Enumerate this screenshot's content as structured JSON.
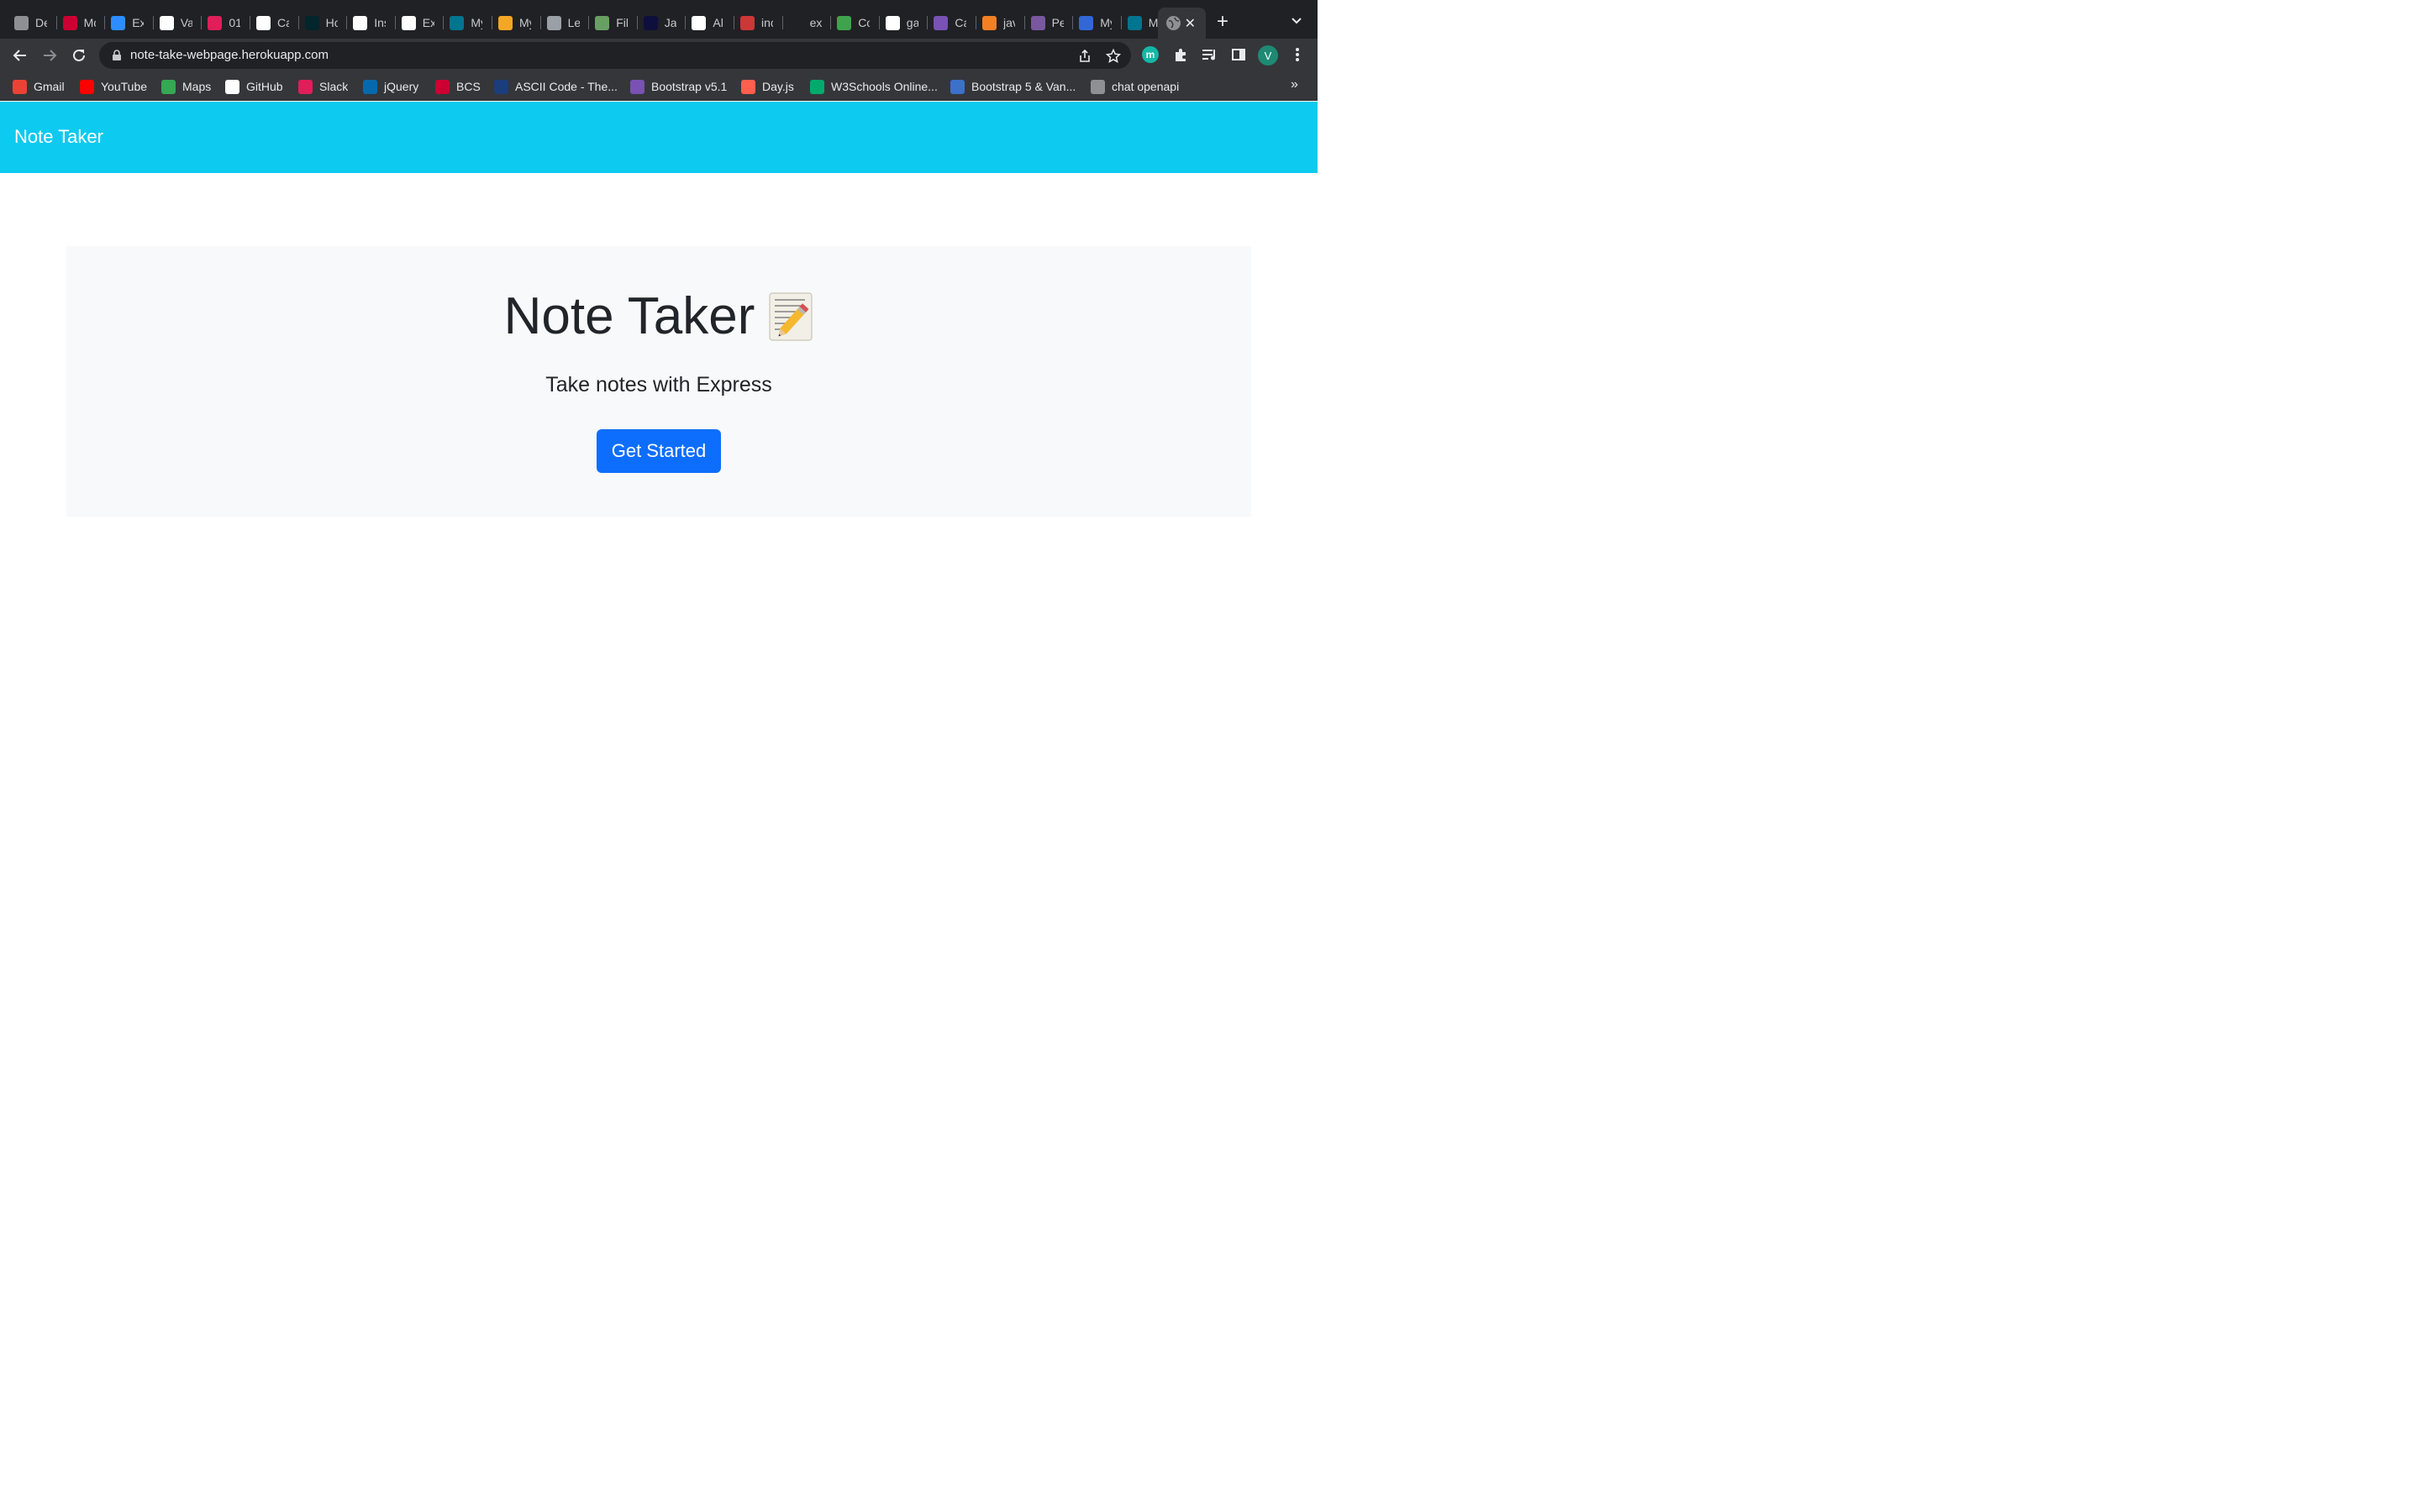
{
  "browser": {
    "tabs": [
      {
        "title": "De",
        "icon": "openai-icon",
        "color": "#8e9094"
      },
      {
        "title": "Mo",
        "icon": "rutgers-r-icon",
        "color": "#cc0033"
      },
      {
        "title": "Ex",
        "icon": "zoom-icon",
        "color": "#2d8cff"
      },
      {
        "title": "Va",
        "icon": "github-icon",
        "color": "#ffffff"
      },
      {
        "title": "01",
        "icon": "slack-icon",
        "color": "#e01e5a"
      },
      {
        "title": "Ca",
        "icon": "edx-icon",
        "color": "#ffffff"
      },
      {
        "title": "Ho",
        "icon": "edx-small-icon",
        "color": "#02262b"
      },
      {
        "title": "Ins",
        "icon": "express-icon",
        "color": "#ffffff"
      },
      {
        "title": "Ex",
        "icon": "express-icon",
        "color": "#ffffff"
      },
      {
        "title": "My",
        "icon": "mysql-icon",
        "color": "#00758f"
      },
      {
        "title": "My",
        "icon": "fs-icon",
        "color": "#f5a623"
      },
      {
        "title": "Le",
        "icon": "globe-icon",
        "color": "#9aa0a6"
      },
      {
        "title": "Fil",
        "icon": "nodejs-icon",
        "color": "#68a063"
      },
      {
        "title": "Ja",
        "icon": "angular-a-icon",
        "color": "#0f0f3d"
      },
      {
        "title": "Al",
        "icon": "github-icon",
        "color": "#ffffff"
      },
      {
        "title": "inc",
        "icon": "npm-icon",
        "color": "#cb3837"
      },
      {
        "title": "ex",
        "icon": "medium-icon",
        "color": "#202124"
      },
      {
        "title": "Co",
        "icon": "link-icon",
        "color": "#3fa34d"
      },
      {
        "title": "ga",
        "icon": "google-icon",
        "color": "#ffffff"
      },
      {
        "title": "Ca",
        "icon": "bootstrap-icon",
        "color": "#7952b3"
      },
      {
        "title": "jav",
        "icon": "stackoverflow-icon",
        "color": "#f48024"
      },
      {
        "title": "Pe",
        "icon": "heroku-icon",
        "color": "#79589f"
      },
      {
        "title": "My",
        "icon": "earth-icon",
        "color": "#3367d6"
      },
      {
        "title": "My",
        "icon": "mysql-icon",
        "color": "#00758f"
      }
    ],
    "active_tab": {
      "icon": "globe-icon",
      "close": "✕"
    },
    "new_tab": "+",
    "url": "note-take-webpage.herokuapp.com",
    "extension_m": "m",
    "profile_initial": "V",
    "bookmarks": [
      {
        "label": "Gmail",
        "icon": "gmail-icon",
        "color": "#ea4335"
      },
      {
        "label": "YouTube",
        "icon": "youtube-icon",
        "color": "#ff0000"
      },
      {
        "label": "Maps",
        "icon": "maps-icon",
        "color": "#34a853"
      },
      {
        "label": "GitHub",
        "icon": "github-icon",
        "color": "#ffffff"
      },
      {
        "label": "Slack",
        "icon": "slack-icon",
        "color": "#e01e5a"
      },
      {
        "label": "jQuery",
        "icon": "jquery-icon",
        "color": "#0769ad"
      },
      {
        "label": "BCS",
        "icon": "rutgers-r-icon",
        "color": "#cc0033"
      },
      {
        "label": "ASCII Code - The...",
        "icon": "ascii-icon",
        "color": "#1a3d7c"
      },
      {
        "label": "Bootstrap v5.1",
        "icon": "bootstrap-icon",
        "color": "#7952b3"
      },
      {
        "label": "Day.js",
        "icon": "dayjs-icon",
        "color": "#ff5f4c"
      },
      {
        "label": "W3Schools Online...",
        "icon": "w3schools-icon",
        "color": "#04aa6d"
      },
      {
        "label": "Bootstrap 5 & Van...",
        "icon": "mdb-icon",
        "color": "#3b71ca"
      },
      {
        "label": "chat openapi",
        "icon": "openai-icon",
        "color": "#8e9094"
      }
    ],
    "bookmarks_more": "»"
  },
  "page": {
    "navbar_brand": "Note Taker",
    "navbar_color": "#0dcaf0",
    "headline": "Note Taker",
    "headline_emoji": "memo-icon",
    "subtitle": "Take notes with Express",
    "cta_label": "Get Started",
    "cta_color": "#0d6efd"
  }
}
